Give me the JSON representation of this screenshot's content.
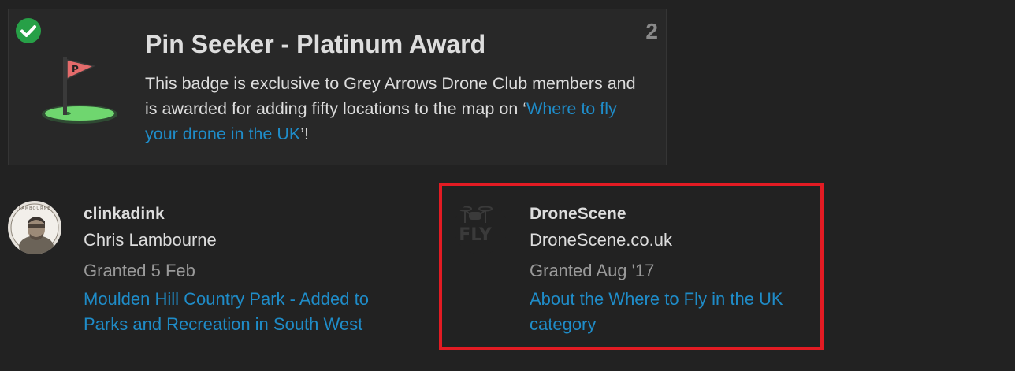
{
  "badge": {
    "title": "Pin Seeker - Platinum Award",
    "count": "2",
    "description_prefix": "This badge is exclusive to Grey Arrows Drone Club members and is awarded for adding fifty locations to the map on ‘",
    "description_link": "Where to fly your drone in the UK",
    "description_suffix": "’!",
    "colors": {
      "check": "#27a047",
      "flag": "#e46b6b",
      "green": "#6fd66f"
    }
  },
  "grants": [
    {
      "username": "clinkadink",
      "name": "Chris Lambourne",
      "granted": "Granted 5 Feb",
      "link": "Moulden Hill Country Park - Added to Parks and Recreation in South West",
      "avatar_icon": "user-photo-avatar",
      "avatar_text": "LAMBOURNE"
    },
    {
      "username": "DroneScene",
      "name": "DroneScene.co.uk",
      "granted": "Granted Aug '17",
      "link": "About the Where to Fly in the UK category",
      "avatar_icon": "drone-fly-logo",
      "avatar_text": "FLY"
    }
  ],
  "highlight_color": "#e21b23"
}
